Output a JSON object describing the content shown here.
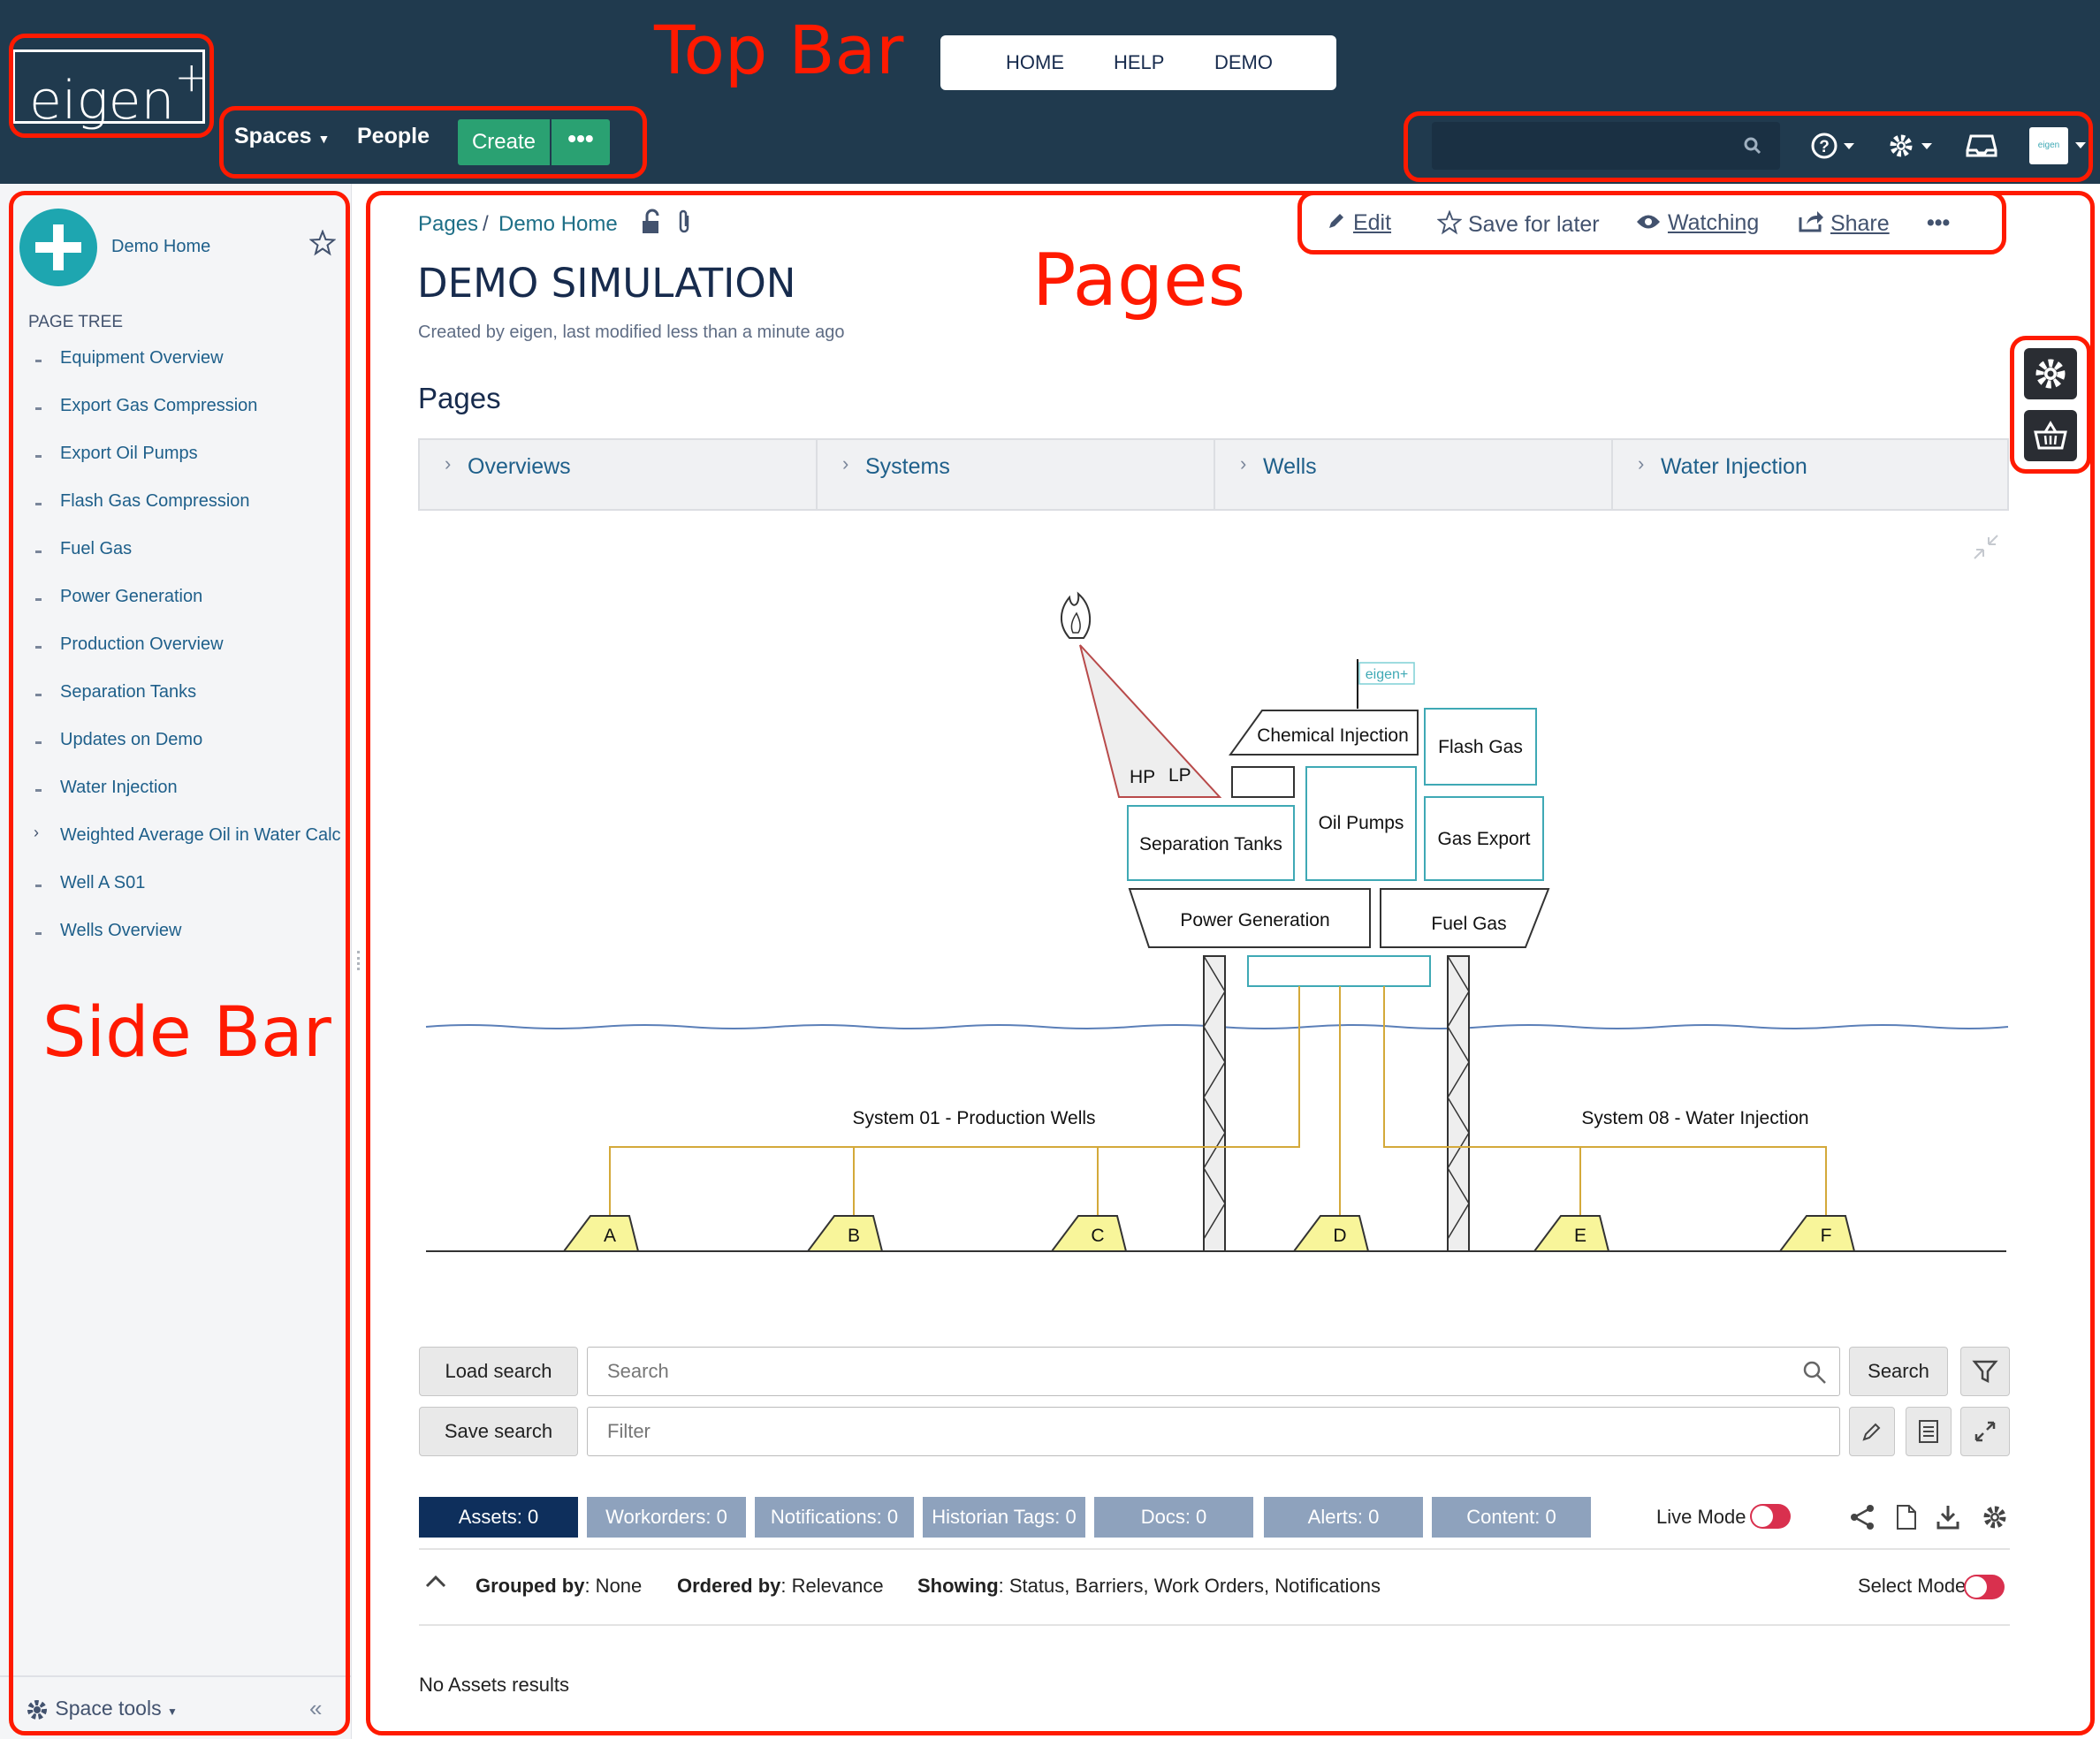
{
  "topbar": {
    "logo_text": "eigen",
    "logo_sup": "+",
    "nav": {
      "spaces": "Spaces",
      "people": "People",
      "create": "Create",
      "more": "•••"
    },
    "menu": {
      "home": "HOME",
      "help": "HELP",
      "demo": "DEMO"
    },
    "avatar_text": "eigen"
  },
  "annotations": {
    "top_bar": "Top Bar",
    "pages": "Pages",
    "side_bar": "Side Bar"
  },
  "sidebar": {
    "space_name": "Demo Home",
    "page_tree_heading": "PAGE TREE",
    "items": [
      {
        "label": "Equipment Overview",
        "expandable": false
      },
      {
        "label": "Export Gas Compression",
        "expandable": false
      },
      {
        "label": "Export Oil Pumps",
        "expandable": false
      },
      {
        "label": "Flash Gas Compression",
        "expandable": false
      },
      {
        "label": "Fuel Gas",
        "expandable": false
      },
      {
        "label": "Power Generation",
        "expandable": false
      },
      {
        "label": "Production Overview",
        "expandable": false
      },
      {
        "label": "Separation Tanks",
        "expandable": false
      },
      {
        "label": "Updates on Demo",
        "expandable": false
      },
      {
        "label": "Water Injection",
        "expandable": false
      },
      {
        "label": "Weighted Average Oil in Water Calc",
        "expandable": true
      },
      {
        "label": "Well A S01",
        "expandable": false
      },
      {
        "label": "Wells Overview",
        "expandable": false
      }
    ],
    "space_tools": "Space tools"
  },
  "page": {
    "breadcrumb": [
      "Pages",
      "Demo Home"
    ],
    "breadcrumb_sep": "/",
    "actions": {
      "edit": "Edit",
      "save_for_later": "Save for later",
      "watching": "Watching",
      "share": "Share",
      "more": "•••"
    },
    "title": "DEMO SIMULATION",
    "byline": "Created by eigen, last modified less than a minute ago",
    "section_heading": "Pages",
    "tabs": [
      "Overviews",
      "Systems",
      "Wells",
      "Water Injection"
    ]
  },
  "diagram": {
    "flare_label_hp": "HP",
    "flare_label_lp": "LP",
    "flag_text": "eigen+",
    "modules": {
      "chemical_injection": "Chemical Injection",
      "flash_gas": "Flash Gas",
      "oil_pumps": "Oil Pumps",
      "gas_export": "Gas Export",
      "separation_tanks": "Separation Tanks",
      "power_generation": "Power Generation",
      "fuel_gas": "Fuel Gas"
    },
    "system_left": "System 01 - Production Wells",
    "system_right": "System 08 - Water Injection",
    "wells": [
      "A",
      "B",
      "C",
      "D",
      "E",
      "F"
    ],
    "colors": {
      "module_border": "#3fa9b5",
      "well_fill": "#f8f59a",
      "pipe": "#d4a93a",
      "flare": "#c0392b",
      "sea": "#5b7fb8"
    }
  },
  "search": {
    "load_search": "Load search",
    "save_search": "Save search",
    "search_placeholder": "Search",
    "filter_placeholder": "Filter",
    "search_button": "Search"
  },
  "results": {
    "pills": [
      "Assets: 0",
      "Workorders: 0",
      "Notifications: 0",
      "Historian Tags: 0",
      "Docs: 0",
      "Alerts: 0",
      "Content: 0"
    ],
    "live_mode": "Live Mode",
    "grouped_by_label": "Grouped by",
    "grouped_by_value": ": None",
    "ordered_by_label": "Ordered by",
    "ordered_by_value": ": Relevance",
    "showing_label": "Showing",
    "showing_value": ": Status, Barriers, Work Orders, Notifications",
    "select_mode": "Select Mode",
    "empty_message": "No Assets results"
  }
}
